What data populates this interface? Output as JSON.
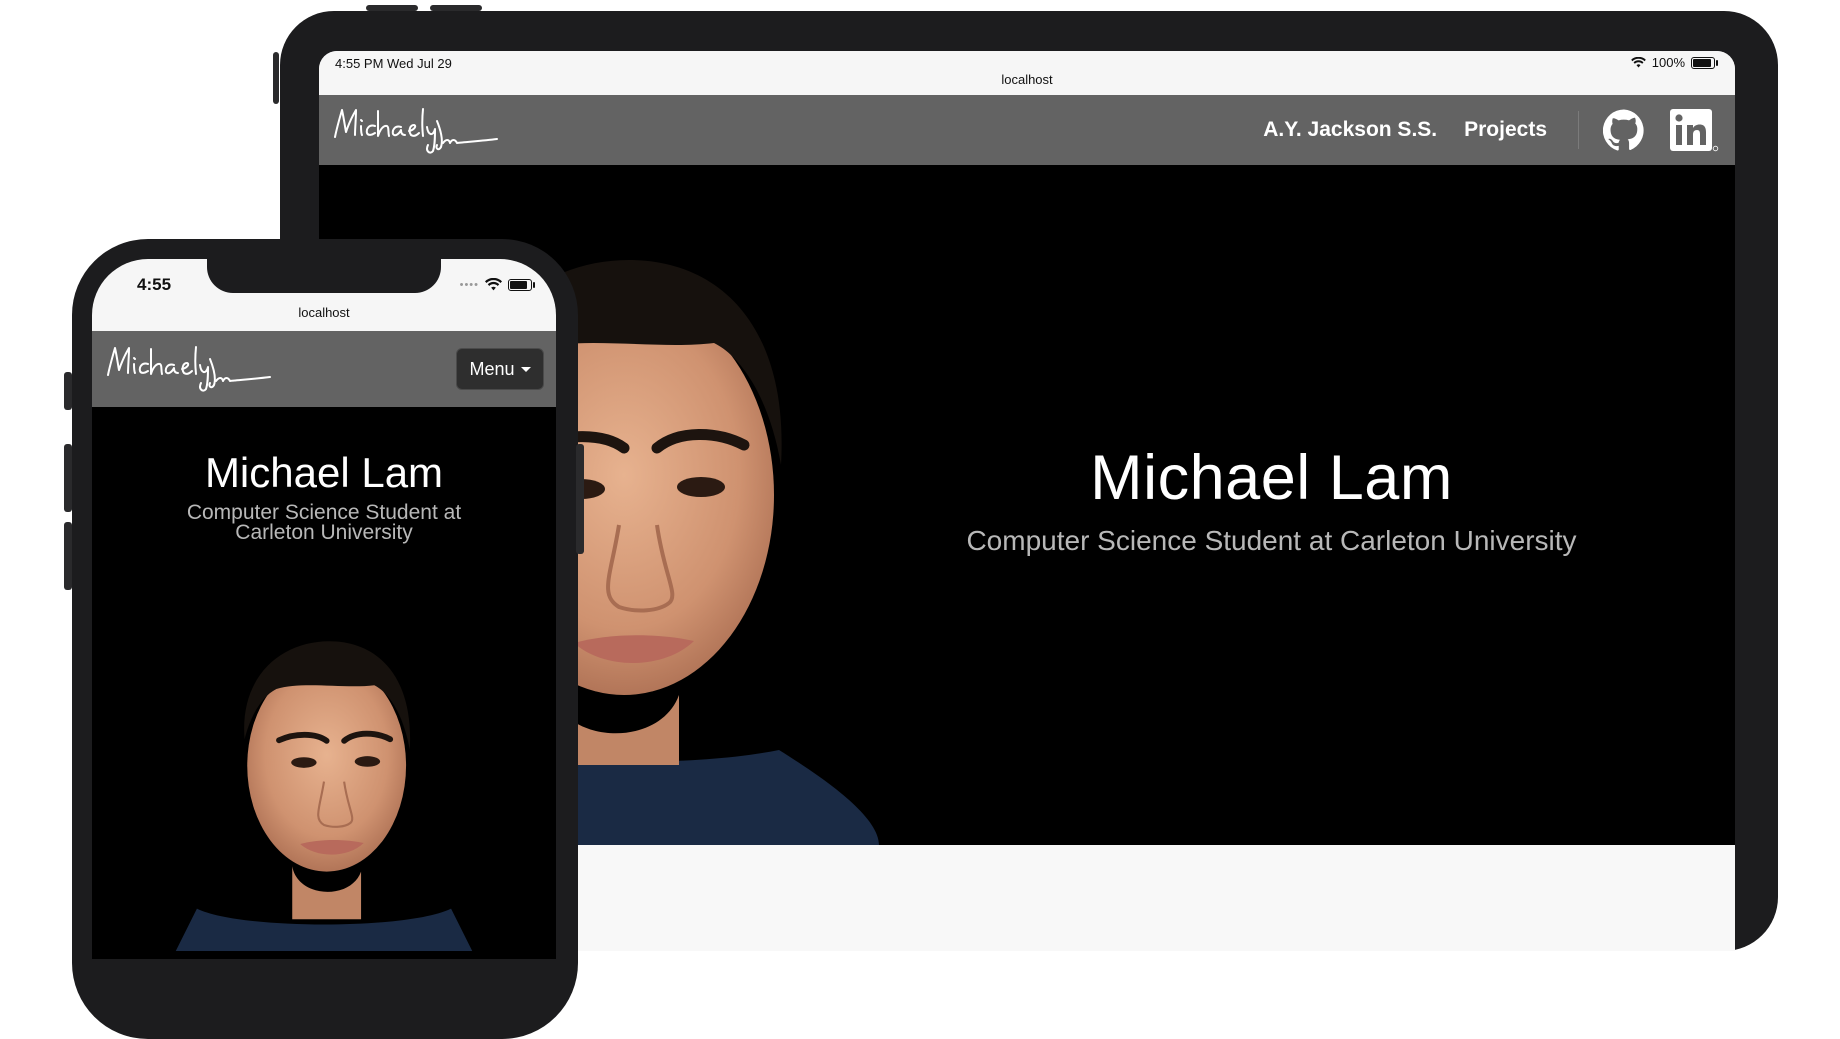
{
  "tablet": {
    "status": {
      "time": "4:55 PM   Wed Jul 29",
      "battery_text": "100%",
      "battery_level": 1.0
    },
    "url": "localhost",
    "nav": {
      "links": [
        "A.Y. Jackson S.S.",
        "Projects"
      ]
    },
    "hero": {
      "name": "Michael Lam",
      "subtitle": "Computer Science Student at Carleton University"
    }
  },
  "phone": {
    "status": {
      "time": "4:55",
      "battery_level": 0.95
    },
    "url": "localhost",
    "menu_label": "Menu",
    "hero": {
      "name": "Michael Lam",
      "subtitle": "Computer Science Student at Carleton University"
    }
  },
  "icons": [
    "signature-logo",
    "wifi-icon",
    "battery-icon",
    "github-icon",
    "linkedin-icon",
    "caret-down-icon"
  ],
  "colors": {
    "navbar": "#636363",
    "hero_bg": "#000000",
    "device_frame": "#1c1c1e",
    "subtitle": "#b8b8b8"
  }
}
